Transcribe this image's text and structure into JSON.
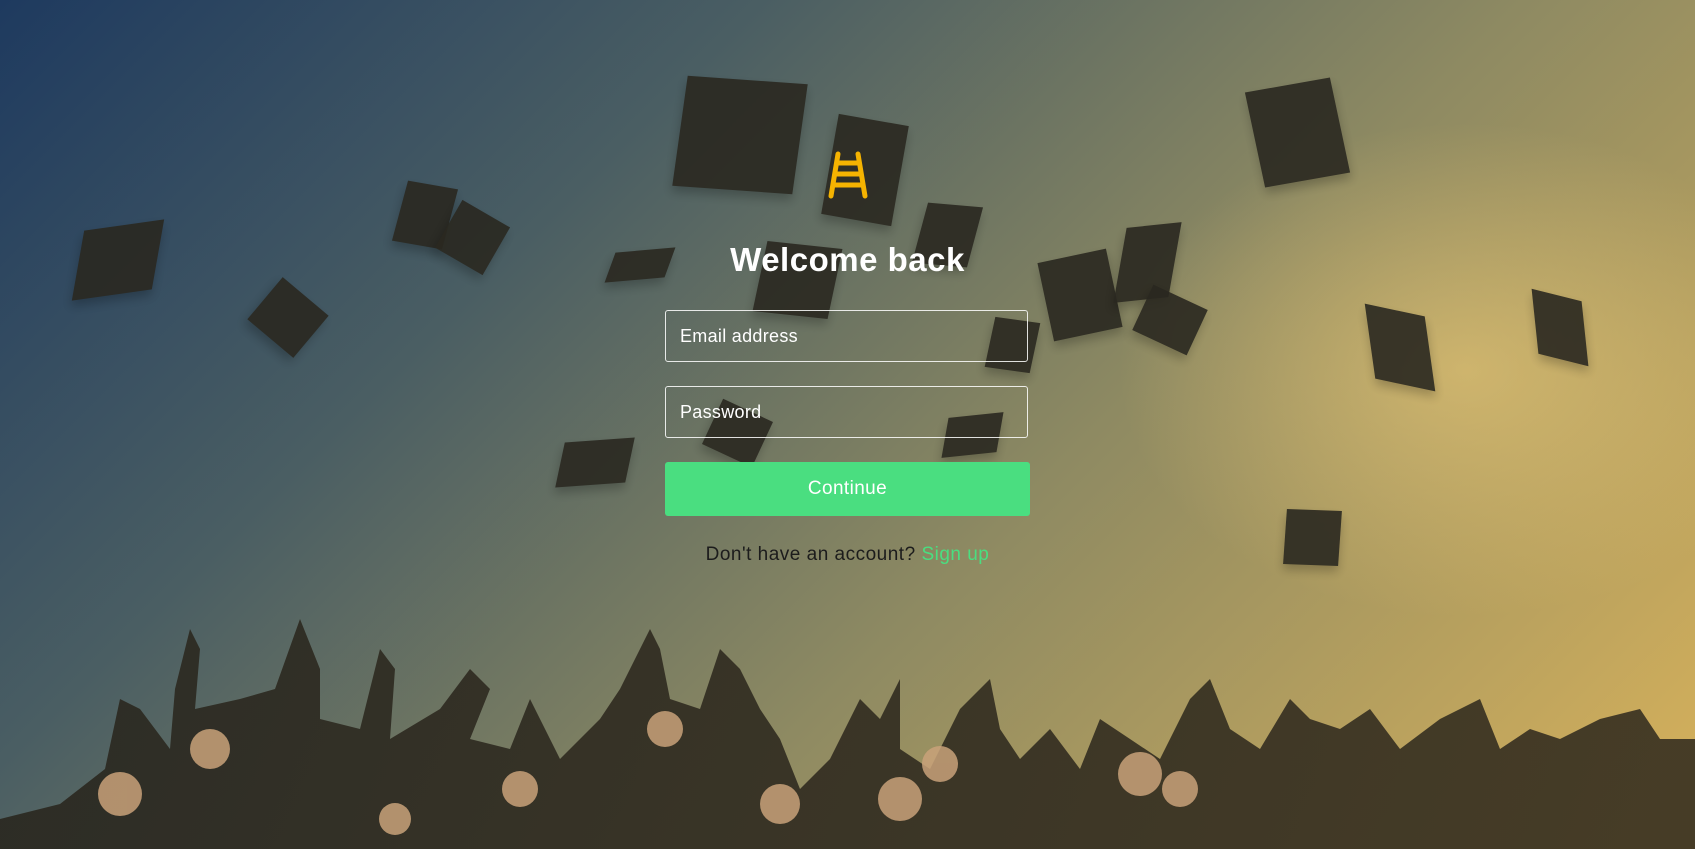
{
  "login": {
    "logo_icon": "ladder-icon",
    "title": "Welcome back",
    "email_placeholder": "Email address",
    "password_placeholder": "Password",
    "continue_label": "Continue",
    "signup_prompt": "Don't have an account?",
    "signup_link": "Sign up"
  },
  "colors": {
    "accent": "#4ade80",
    "logo": "#f5b301",
    "title": "#ffffff"
  },
  "background": {
    "description_icon": "graduation-caps-photo"
  }
}
